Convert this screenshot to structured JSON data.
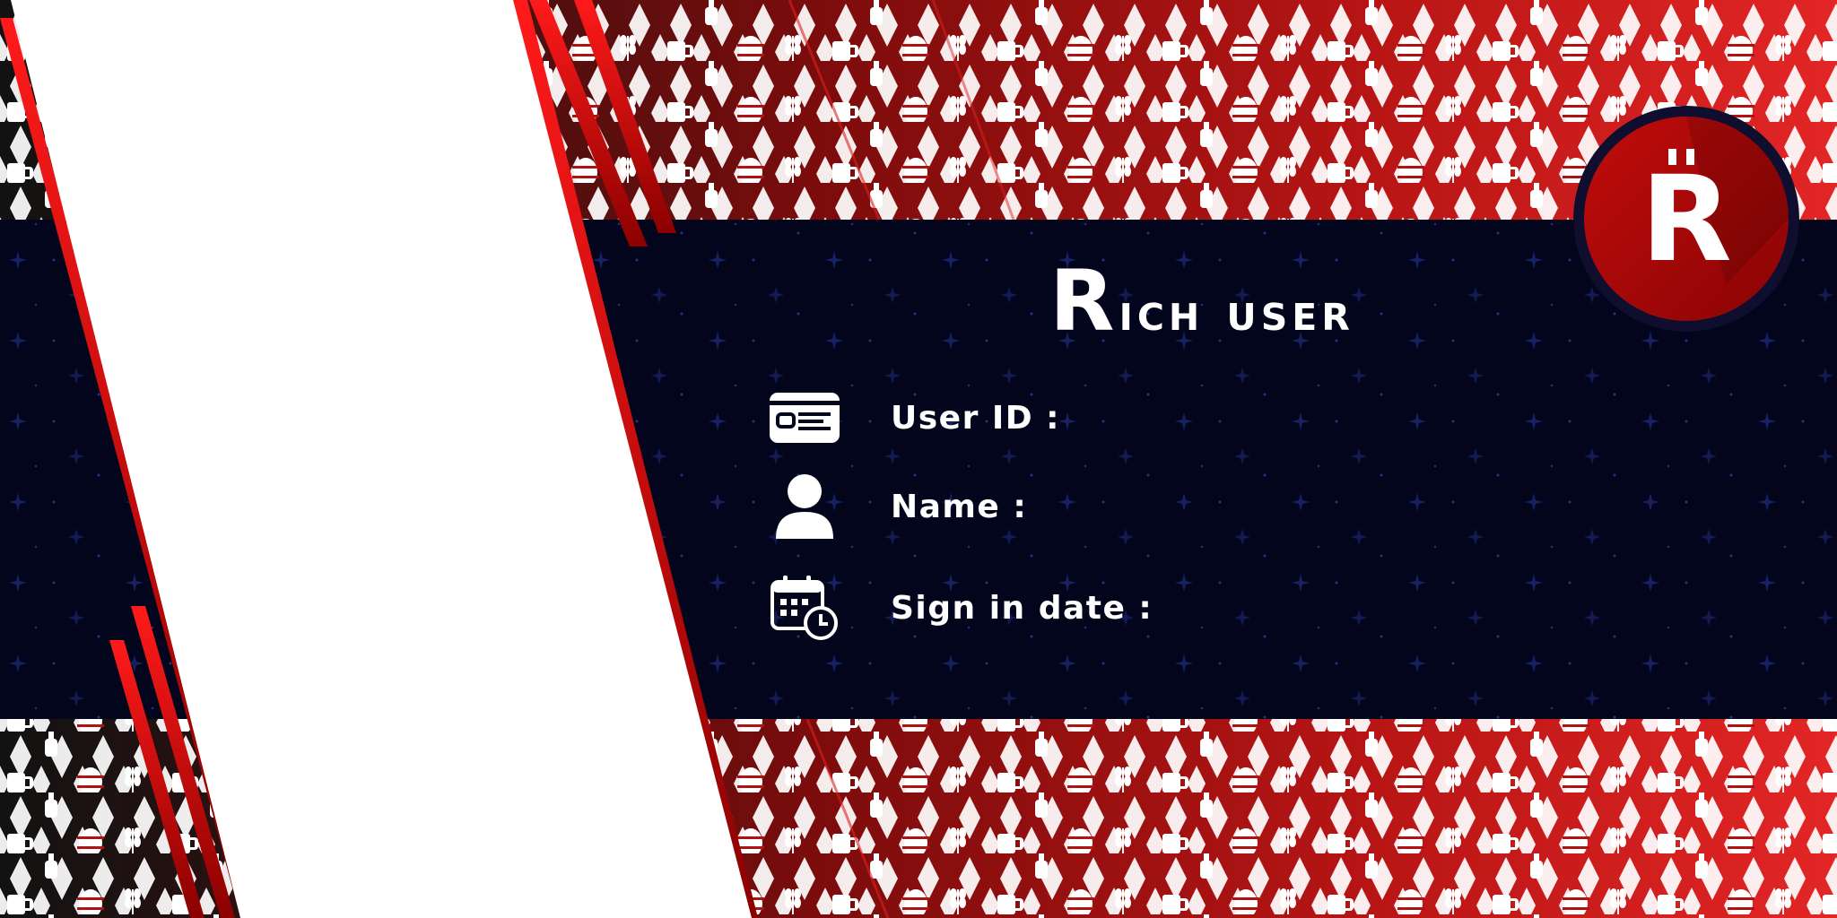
{
  "card": {
    "title": "Rich user",
    "badge_letter": "R",
    "fields": [
      {
        "label": "User ID :",
        "icon": "id-card-icon"
      },
      {
        "label": "Name :",
        "icon": "user-icon"
      },
      {
        "label": "Sign in date :",
        "icon": "calendar-clock-icon"
      }
    ]
  },
  "colors": {
    "band": "#03051c",
    "red_bright": "#e32626",
    "red_dark": "#7d0c0c",
    "badge_red": "#a80808",
    "badge_ring": "#0f0e2e",
    "white": "#ffffff"
  }
}
